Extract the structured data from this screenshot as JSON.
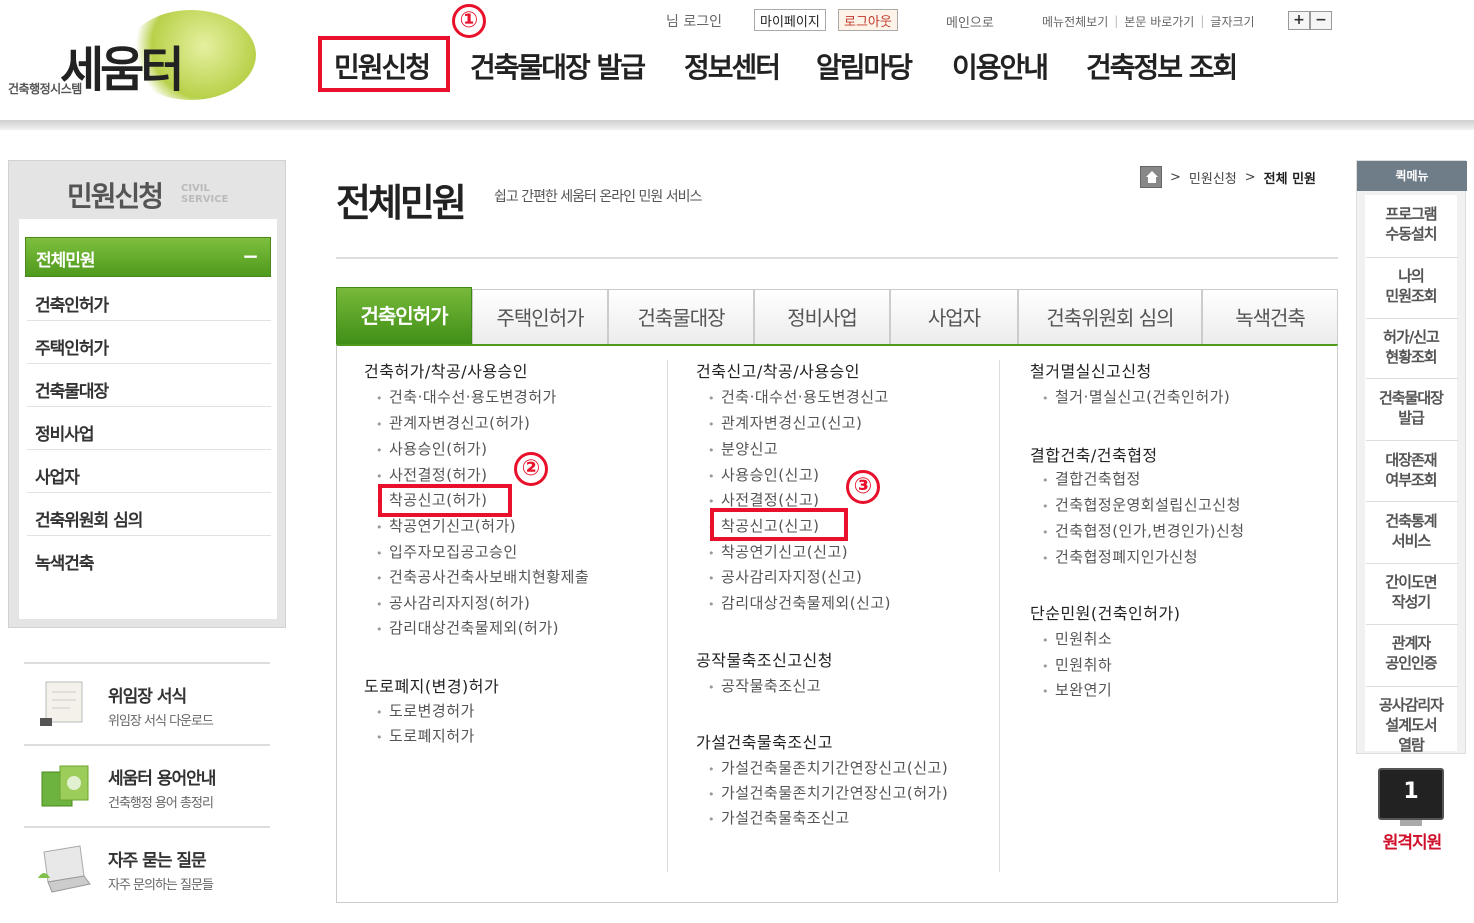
{
  "header": {
    "logo_sub": "건축행정시스템",
    "logo_name": "세움터",
    "user_greeting": "님 로그인",
    "mypage_label": "마이페이지",
    "logout_label": "로그아웃",
    "main_link": "메인으로",
    "util_links": [
      "메뉴전체보기",
      "본문 바로가기",
      "글자크기"
    ],
    "font_plus": "+",
    "font_minus": "−",
    "gnb": [
      "민원신청",
      "건축물대장 발급",
      "정보센터",
      "알림마당",
      "이용안내",
      "건축정보 조회"
    ]
  },
  "markers": [
    "①",
    "②",
    "③"
  ],
  "sidebar": {
    "title": "민원신청",
    "title_en_1": "CIVIL",
    "title_en_2": "SERVICE",
    "active": "전체민원",
    "active_icon": "−",
    "items": [
      "건축인허가",
      "주택인허가",
      "건축물대장",
      "정비사업",
      "사업자",
      "건축위원회 심의",
      "녹색건축"
    ]
  },
  "quick_links": [
    {
      "title": "위임장 서식",
      "sub": "위임장 서식 다운로드"
    },
    {
      "title": "세움터 용어안내",
      "sub": "건축행정 용어 총정리"
    },
    {
      "title": "자주 묻는 질문",
      "sub": "자주 문의하는 질문들"
    }
  ],
  "page": {
    "title": "전체민원",
    "desc": "쉽고 간편한 세움터 온라인 민원 서비스",
    "breadcrumb": [
      "민원신청",
      "전체 민원"
    ]
  },
  "tabs": [
    "건축인허가",
    "주택인허가",
    "건축물대장",
    "정비사업",
    "사업자",
    "건축위원회 심의",
    "녹색건축"
  ],
  "columns": {
    "col1": {
      "groups": [
        {
          "title": "건축허가/착공/사용승인",
          "items": [
            "건축·대수선·용도변경허가",
            "관계자변경신고(허가)",
            "사용승인(허가)",
            "사전결정(허가)",
            "착공신고(허가)",
            "착공연기신고(허가)",
            "입주자모집공고승인",
            "건축공사건축사보배치현황제출",
            "공사감리자지정(허가)",
            "감리대상건축물제외(허가)"
          ]
        },
        {
          "title": "도로폐지(변경)허가",
          "items": [
            "도로변경허가",
            "도로폐지허가"
          ]
        }
      ]
    },
    "col2": {
      "groups": [
        {
          "title": "건축신고/착공/사용승인",
          "items": [
            "건축·대수선·용도변경신고",
            "관계자변경신고(신고)",
            "분양신고",
            "사용승인(신고)",
            "사전결정(신고)",
            "착공신고(신고)",
            "착공연기신고(신고)",
            "공사감리자지정(신고)",
            "감리대상건축물제외(신고)"
          ]
        },
        {
          "title": "공작물축조신고신청",
          "items": [
            "공작물축조신고"
          ]
        },
        {
          "title": "가설건축물축조신고",
          "items": [
            "가설건축물존치기간연장신고(신고)",
            "가설건축물존치기간연장신고(허가)",
            "가설건축물축조신고"
          ]
        }
      ]
    },
    "col3": {
      "groups": [
        {
          "title": "철거멸실신고신청",
          "items": [
            "철거·멸실신고(건축인허가)"
          ]
        },
        {
          "title": "결합건축/건축협정",
          "items": [
            "결합건축협정",
            "건축협정운영회설립신고신청",
            "건축협정(인가,변경인가)신청",
            "건축협정폐지인가신청"
          ]
        },
        {
          "title": "단순민원(건축인허가)",
          "items": [
            "민원취소",
            "민원취하",
            "보완연기"
          ]
        }
      ]
    }
  },
  "quick_menu": {
    "title": "퀵메뉴",
    "items": [
      "프로그램\n수동설치",
      "나의\n민원조회",
      "허가/신고\n현황조회",
      "건축물대장\n발급",
      "대장존재\n여부조회",
      "건축통계\n서비스",
      "간이도면\n작성기",
      "관계자\n공인인증",
      "공사감리자\n설계도서\n열람"
    ],
    "remote_number": "1",
    "remote_label": "원격지원"
  },
  "colors": {
    "accent_green": "#4f9a1e",
    "highlight_red": "#e8102a"
  }
}
